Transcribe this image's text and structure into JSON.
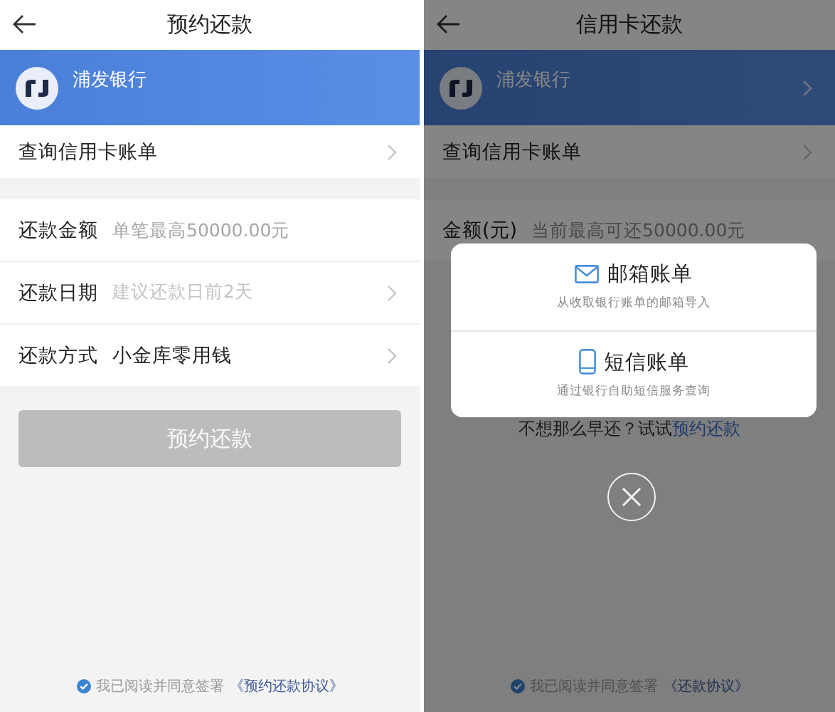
{
  "screens": [
    {
      "title": "预约还款",
      "dimmed": false,
      "bank": {
        "name": "浦发银行",
        "chevron": false
      },
      "query_row": {
        "label": "查询信用卡账单"
      },
      "fields": [
        {
          "kind": "input",
          "label": "还款金额",
          "placeholder": "单笔最高50000.00元"
        },
        {
          "kind": "select",
          "label": "还款日期",
          "placeholder": "建议还款日前2天"
        },
        {
          "kind": "select",
          "label": "还款方式",
          "value": "小金库零用钱"
        }
      ],
      "submit": {
        "label": "预约还款",
        "disabled": true
      },
      "agreement": {
        "checked": true,
        "text": "我已阅读并同意签署",
        "link": "《预约还款协议》"
      }
    },
    {
      "title": "信用卡还款",
      "dimmed": true,
      "bank": {
        "name": "浦发银行",
        "chevron": true
      },
      "query_row": {
        "label": "查询信用卡账单"
      },
      "fields": [
        {
          "kind": "input",
          "label": "金额(元)",
          "placeholder": "当前最高可还50000.00元"
        }
      ],
      "hint": {
        "text": "不想那么早还？试试",
        "link": "预约还款"
      },
      "agreement": {
        "checked": true,
        "text": "我已阅读并同意签署",
        "link": "《还款协议》"
      },
      "modal": {
        "options": [
          {
            "kind": "mail",
            "title": "邮箱账单",
            "subtitle": "从收取银行账单的邮箱导入"
          },
          {
            "kind": "phone",
            "title": "短信账单",
            "subtitle": "通过银行自助短信服务查询"
          }
        ]
      }
    }
  ]
}
